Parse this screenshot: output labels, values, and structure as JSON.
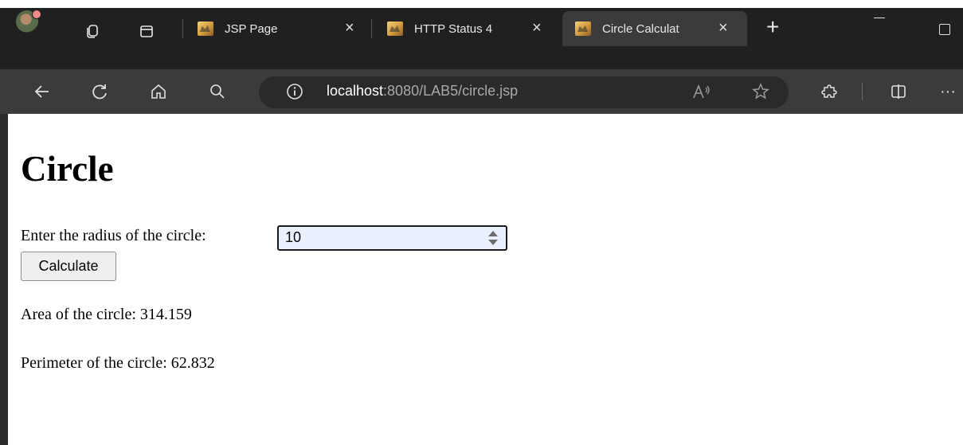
{
  "browser": {
    "tabs": [
      {
        "title": "JSP Page",
        "active": false
      },
      {
        "title": "HTTP Status 4",
        "active": false
      },
      {
        "title": "Circle Calculat",
        "active": true
      }
    ],
    "url": {
      "host": "localhost",
      "rest": ":8080/LAB5/circle.jsp"
    }
  },
  "page": {
    "heading": "Circle",
    "radius_label": "Enter the radius of the circle:",
    "radius_value": "10",
    "calculate_label": "Calculate",
    "area_text": "Area of the circle: 314.159",
    "perimeter_text": "Perimeter of the circle: 62.832"
  },
  "icons": {
    "close": "×",
    "more": "···"
  }
}
